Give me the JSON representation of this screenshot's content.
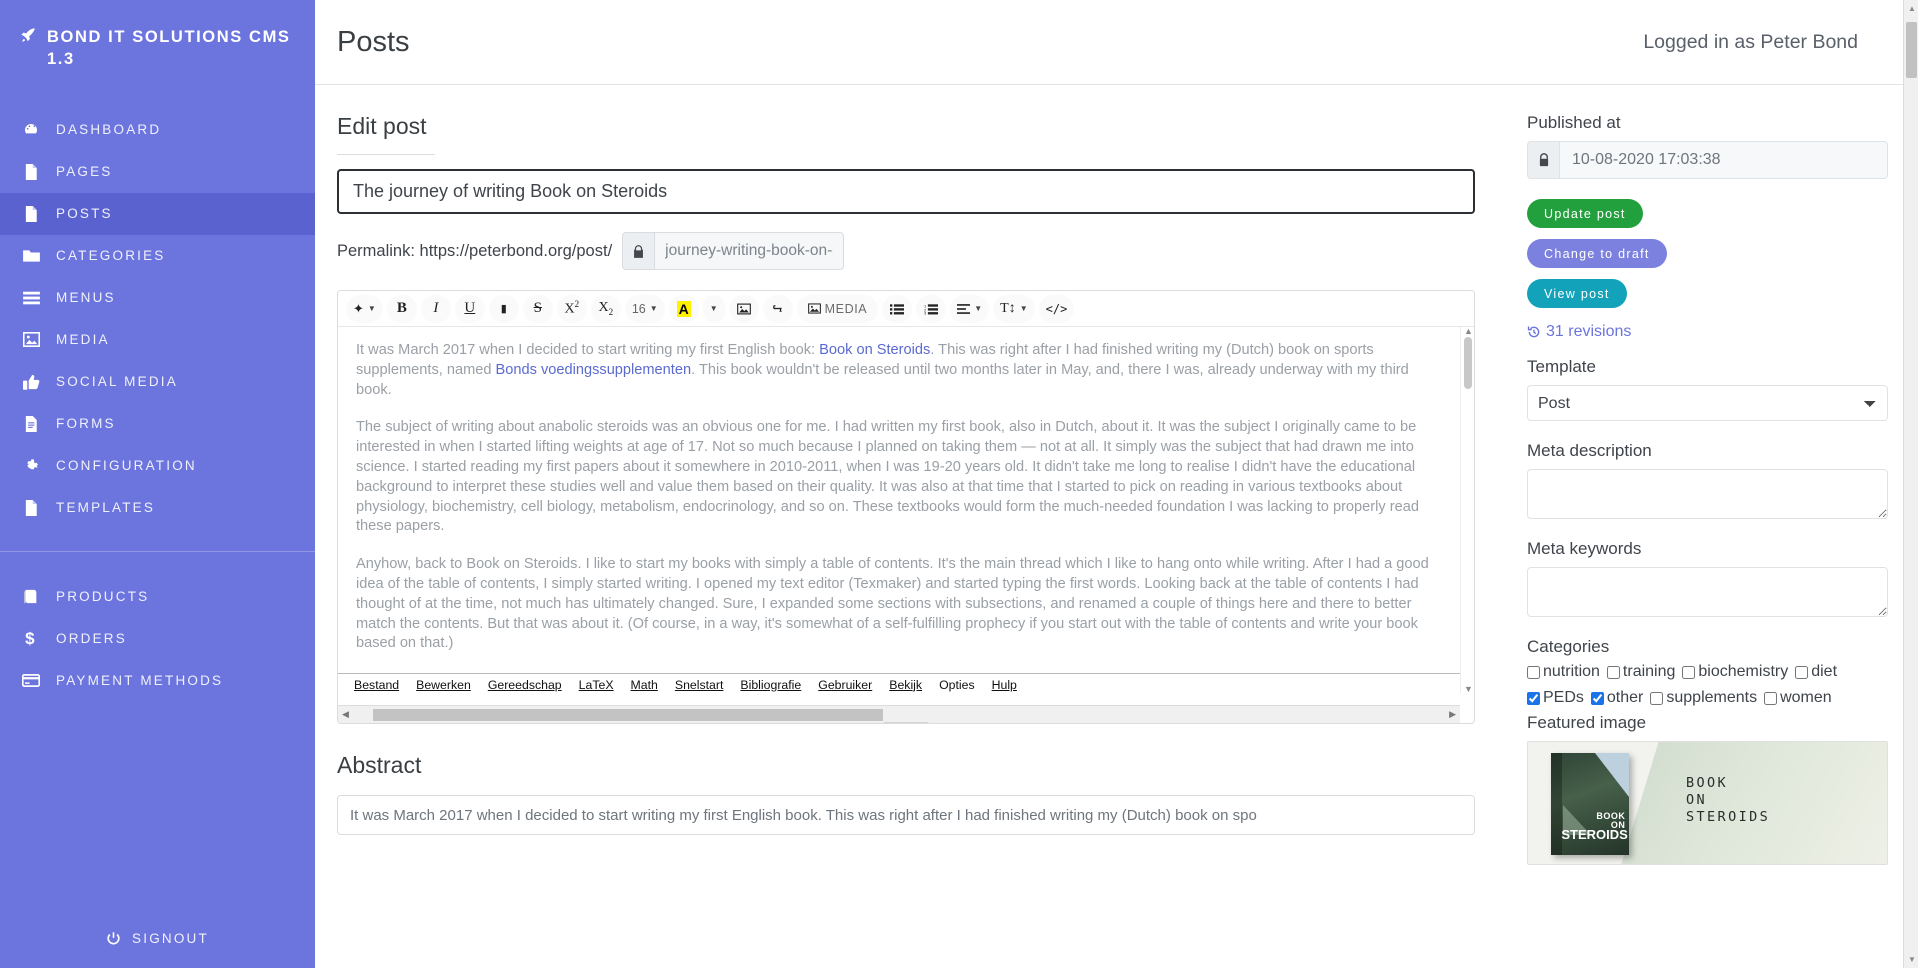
{
  "sidebar": {
    "brand": "Bond IT Solutions CMS 1.3",
    "brand_icon": "rocket-icon",
    "items": [
      {
        "label": "Dashboard",
        "icon": "dashboard-icon",
        "active": false
      },
      {
        "label": "Pages",
        "icon": "file-icon",
        "active": false
      },
      {
        "label": "Posts",
        "icon": "file-icon",
        "active": true
      },
      {
        "label": "Categories",
        "icon": "folder-icon",
        "active": false
      },
      {
        "label": "Menus",
        "icon": "bars-icon",
        "active": false
      },
      {
        "label": "Media",
        "icon": "image-icon",
        "active": false
      },
      {
        "label": "Social Media",
        "icon": "thumbs-up-icon",
        "active": false
      },
      {
        "label": "Forms",
        "icon": "file-lines-icon",
        "active": false
      },
      {
        "label": "Configuration",
        "icon": "gear-icon",
        "active": false
      },
      {
        "label": "Templates",
        "icon": "file-icon",
        "active": false
      }
    ],
    "items2": [
      {
        "label": "Products",
        "icon": "book-icon",
        "active": false
      },
      {
        "label": "Orders",
        "icon": "dollar-icon",
        "active": false
      },
      {
        "label": "Payment methods",
        "icon": "credit-card-icon",
        "active": false
      }
    ],
    "signout": "Signout",
    "signout_icon": "power-icon",
    "bg_color": "#6c74dd",
    "active_color": "#5a62d0"
  },
  "topbar": {
    "title": "Posts",
    "user_status": "Logged in as Peter Bond"
  },
  "edit": {
    "heading": "Edit post",
    "title_value": "The journey of writing Book on Steroids",
    "permalink_label": "Permalink: https://peterbond.org/post/",
    "slug_value": "journey-writing-book-on-s",
    "slug_lock_icon": "lock-icon",
    "abstract_heading": "Abstract",
    "abstract_value": "It was March 2017 when I decided to start writing my first English book. This was right after I had finished writing my (Dutch) book on spo"
  },
  "toolbar": {
    "buttons": [
      {
        "name": "style-eraser",
        "glyph": "✦",
        "caret": true
      },
      {
        "name": "bold",
        "glyph": "B"
      },
      {
        "name": "italic",
        "glyph": "I"
      },
      {
        "name": "underline",
        "glyph": "U"
      },
      {
        "name": "eraser",
        "glyph": "▬"
      },
      {
        "name": "strikethrough",
        "glyph": "S"
      },
      {
        "name": "superscript",
        "glyph": "X²"
      },
      {
        "name": "subscript",
        "glyph": "X₂"
      },
      {
        "name": "font-size",
        "glyph": "16",
        "caret": true
      },
      {
        "name": "text-color",
        "glyph": "A",
        "caret": true
      },
      {
        "name": "image",
        "glyph": "Ὓc"
      },
      {
        "name": "link",
        "glyph": "ὑ7"
      },
      {
        "name": "media",
        "glyph": "Ὓc",
        "label": "MEDIA"
      },
      {
        "name": "unordered-list",
        "glyph": "☰"
      },
      {
        "name": "ordered-list",
        "glyph": "☰"
      },
      {
        "name": "align",
        "glyph": "≡",
        "caret": true
      },
      {
        "name": "line-height",
        "glyph": "T↕",
        "caret": true
      },
      {
        "name": "source-code",
        "glyph": "</>"
      }
    ],
    "font_size": "16",
    "media_label": "MEDIA"
  },
  "editor_content": {
    "paragraphs": [
      {
        "parts": [
          {
            "t": "It was March 2017 when I decided to start writing my first English book: "
          },
          {
            "t": "Book on Steroids",
            "link": true
          },
          {
            "t": ". This was right after I had finished writing my (Dutch) book on sports supplements, named "
          },
          {
            "t": "Bonds voedingssupplementen",
            "link": true
          },
          {
            "t": ". This book wouldn't be released until two months later in May, and, there I was, already underway with my third book."
          }
        ]
      },
      {
        "parts": [
          {
            "t": "The subject of writing about anabolic steroids was an obvious one for me. I had written my first book, also in Dutch, about it. It was the subject I originally came to be interested in when I started lifting weights at age of 17. Not so much because I planned on taking them — not at all. It simply was the subject that had drawn me into science. I started reading my first papers about it somewhere in 2010-2011, when I was 19-20 years old. It didn't take me long to realise I didn't have the educational background to interpret these studies well and value them based on their quality. It was also at that time that I started to pick on reading in various textbooks about physiology, biochemistry, cell biology, metabolism, endocrinology, and so on. These textbooks would form the much-needed foundation I was lacking to properly read these papers."
          }
        ]
      },
      {
        "parts": [
          {
            "t": "Anyhow, back to Book on Steroids. I like to start my books with simply a table of contents. It's the main thread which I like to hang onto while writing. After I had a good idea of the table of contents, I simply started writing. I opened my text editor (Texmaker) and started typing the first words. Looking back at the table of contents I had thought of at the time, not much has ultimately changed. Sure, I expanded some sections with subsections, and renamed a couple of things here and there to better match the contents. But that was about it. (Of course, in a way, it's somewhat of a self-fulfilling prophecy if you start out with the table of contents and write your book based on that.)"
          }
        ]
      }
    ],
    "app_menu": [
      "Bestand",
      "Bewerken",
      "Gereedschap",
      "LaTeX",
      "Math",
      "Snelstart",
      "Bibliografie",
      "Gebruiker",
      "Bekijk",
      "Opties",
      "Hulp"
    ]
  },
  "right_panel": {
    "published_label": "Published at",
    "published_value": "10-08-2020 17:03:38",
    "published_lock_icon": "lock-icon",
    "update_button": "Update post",
    "draft_button": "Change to draft",
    "view_button": "View post",
    "revisions": "31 revisions",
    "revisions_icon": "history-icon",
    "template_label": "Template",
    "template_value": "Post",
    "template_options": [
      "Post"
    ],
    "meta_description_label": "Meta description",
    "meta_description_value": "",
    "meta_keywords_label": "Meta keywords",
    "meta_keywords_value": "",
    "categories_label": "Categories",
    "categories": [
      {
        "label": "nutrition",
        "checked": false
      },
      {
        "label": "training",
        "checked": false
      },
      {
        "label": "biochemistry",
        "checked": false
      },
      {
        "label": "diet",
        "checked": false
      },
      {
        "label": "PEDs",
        "checked": true
      },
      {
        "label": "other",
        "checked": true
      },
      {
        "label": "supplements",
        "checked": false
      },
      {
        "label": "women",
        "checked": false
      }
    ],
    "featured_label": "Featured image",
    "featured_image_title": "Book On Steroids",
    "featured_book_line1": "BOOK",
    "featured_book_line2": "ON",
    "featured_book_line3": "STEROIDS",
    "colors": {
      "update": "#23a03e",
      "draft": "#7c81e0",
      "view": "#12a3ba",
      "link": "#6c74dd"
    }
  }
}
